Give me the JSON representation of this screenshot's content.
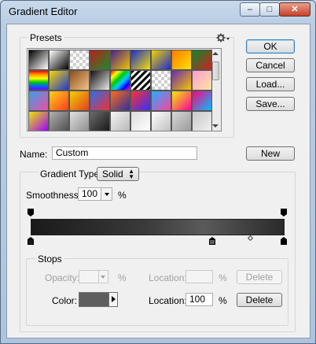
{
  "window": {
    "title": "Gradient Editor",
    "controls": {
      "minimize": "–",
      "maximize": "□",
      "close": "✕"
    },
    "accent": "#b9cde3"
  },
  "presets": {
    "label": "Presets",
    "menu_icon": "gear-icon",
    "swatches": [
      [
        "#000000|#ffffff",
        "#ffffff|#000000",
        "checker",
        "#b8201c|#1e8b2a",
        "#4a1f8f|#f0c400",
        "#1a2bd0|#f5e000",
        "#f3d300|#1a2bd0",
        "#ff7a00|#ffe200",
        "#0a8a2c|#d02020"
      ],
      [
        "rainbow-v",
        "#f6d600|#1b39d9",
        "#8b4e1a|#f4c38a",
        "#101010|#e8e8e8",
        "rainbow-d",
        "stripes",
        "checker",
        "#6d2bb0|#f4c400",
        "#ff9bd2|#ffe6a0"
      ],
      [
        "#38a0e8|#f04ea0",
        "#ffd11a|#ff3c1f",
        "#f4d000|#e04020",
        "#2a6df0|#f03030",
        "#ff6c1a|#2e2e9e",
        "#ff3030|#3030ff",
        "#20b0ff|#ff40a0",
        "#f0f000|#ff00a0",
        "#ff0080|#00c0ff"
      ],
      [
        "#e8e800|#a000ff",
        "#b0b0b0|#505050",
        "#e0e0e0|#909090",
        "#6a6a6a|#1a1a1a",
        "#f5f5f5|#b8b8b8",
        "#dcdcdc|#ffffff",
        "#ffffff|#c0c0c0",
        "#d8d8d8|#9a9a9a",
        "#c8c8c8|#f0f0f0"
      ]
    ]
  },
  "buttons": {
    "ok": "OK",
    "cancel": "Cancel",
    "load": "Load...",
    "save": "Save...",
    "new": "New"
  },
  "name": {
    "label": "Name:",
    "value": "Custom"
  },
  "gradient": {
    "type_label": "Gradient Type:",
    "type_value": "Solid",
    "smoothness_label": "Smoothness:",
    "smoothness_value": "100",
    "smoothness_unit": "%"
  },
  "stops": {
    "label": "Stops",
    "opacity_label": "Opacity:",
    "opacity_value": "",
    "opacity_unit": "%",
    "opacity_location_label": "Location:",
    "opacity_location_value": "",
    "opacity_location_unit": "%",
    "opacity_delete": "Delete",
    "color_label": "Color:",
    "color_swatch": "#5e5e5e",
    "color_location_label": "Location:",
    "color_location_value": "100",
    "color_location_unit": "%",
    "color_delete": "Delete"
  }
}
